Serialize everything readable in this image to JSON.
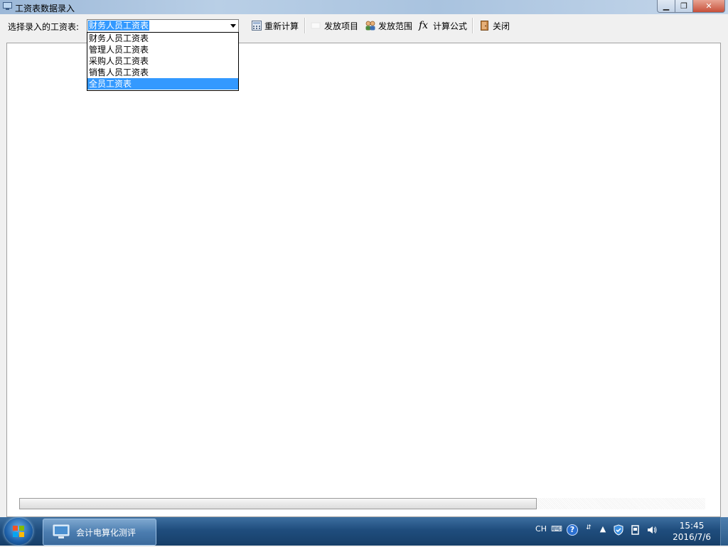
{
  "window": {
    "title": "工资表数据录入"
  },
  "toolbar": {
    "select_label": "选择录入的工资表:",
    "selected_table": "财务人员工资表",
    "recalc": "重新计算",
    "items": "发放项目",
    "scope": "发放范围",
    "formula": "计算公式",
    "close": "关闭"
  },
  "dropdown": {
    "options": [
      "财务人员工资表",
      "管理人员工资表",
      "采购人员工资表",
      "销售人员工资表",
      "全员工资表"
    ],
    "highlighted_index": 4
  },
  "taskbar": {
    "task_title": "会计电算化测评",
    "lang": "CH",
    "time": "15:45",
    "date": "2016/7/6"
  },
  "colors": {
    "selection": "#3399ff",
    "taskbar": "#1f4d7d"
  }
}
